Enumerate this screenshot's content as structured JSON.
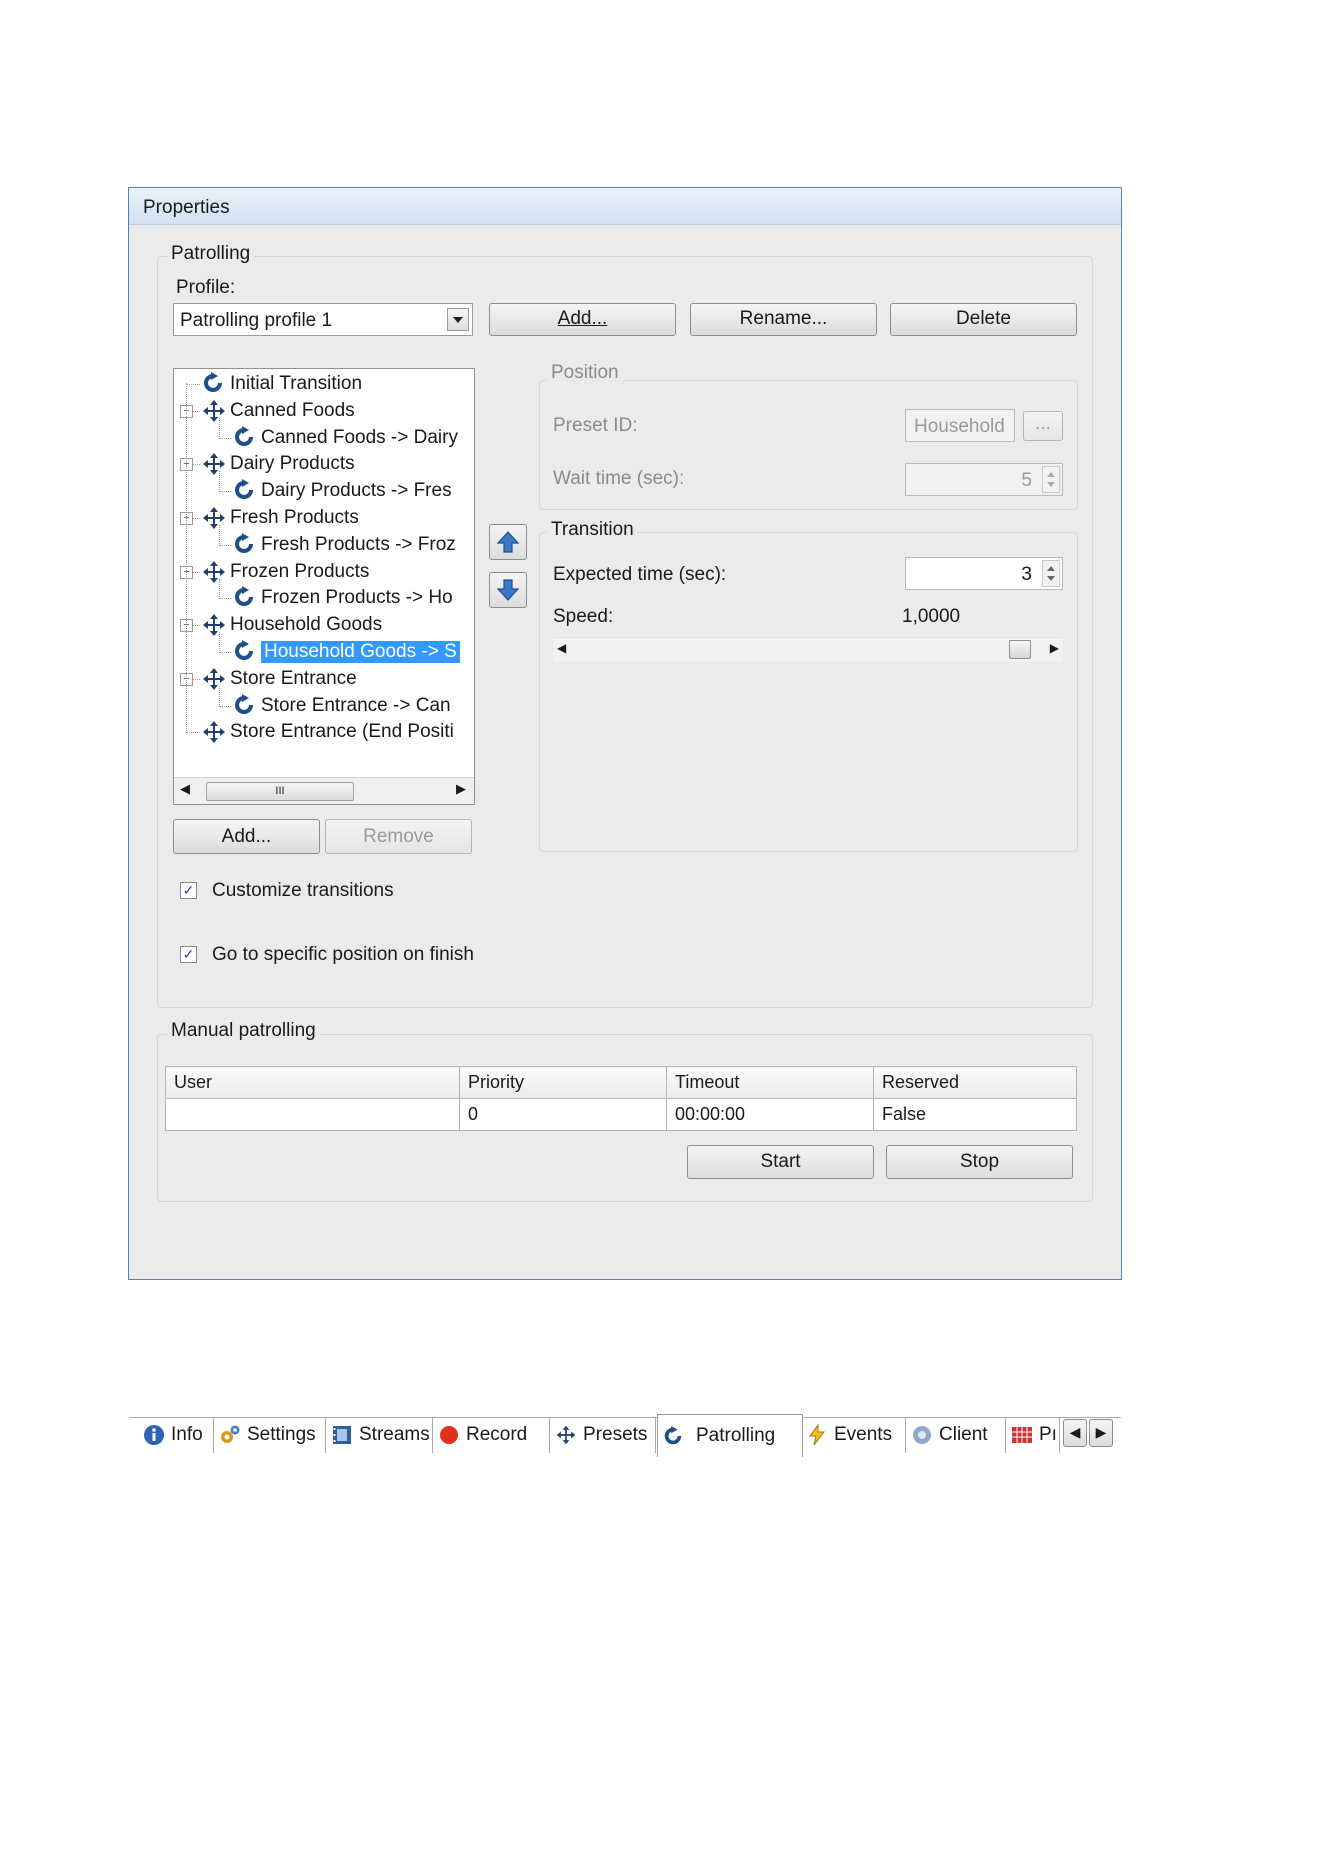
{
  "window": {
    "title": "Properties"
  },
  "patrolling": {
    "legend": "Patrolling",
    "profile_label": "Profile:",
    "profile_value": "Patrolling profile 1",
    "add_label": "Add...",
    "rename_label": "Rename...",
    "delete_label": "Delete",
    "tree": [
      {
        "label": "Initial Transition",
        "icon": "rotate-icon",
        "level": 0
      },
      {
        "label": "Canned Foods",
        "icon": "move-icon",
        "level": 0
      },
      {
        "label": "Canned Foods -> Dairy",
        "icon": "rotate-icon",
        "level": 1
      },
      {
        "label": "Dairy Products",
        "icon": "move-icon",
        "level": 0
      },
      {
        "label": "Dairy Products -> Fres",
        "icon": "rotate-icon",
        "level": 1
      },
      {
        "label": "Fresh Products",
        "icon": "move-icon",
        "level": 0
      },
      {
        "label": "Fresh Products -> Froz",
        "icon": "rotate-icon",
        "level": 1
      },
      {
        "label": "Frozen Products",
        "icon": "move-icon",
        "level": 0
      },
      {
        "label": "Frozen Products -> Ho",
        "icon": "rotate-icon",
        "level": 1
      },
      {
        "label": "Household Goods",
        "icon": "move-icon",
        "level": 0
      },
      {
        "label": "Household Goods -> S",
        "icon": "rotate-icon",
        "level": 1,
        "selected": true
      },
      {
        "label": "Store Entrance",
        "icon": "move-icon",
        "level": 0
      },
      {
        "label": "Store Entrance -> Can",
        "icon": "rotate-icon",
        "level": 1
      },
      {
        "label": "Store Entrance (End Positi",
        "icon": "move-icon",
        "level": 0
      }
    ],
    "tree_scroll_grip": "III",
    "tree_add_label": "Add...",
    "tree_remove_label": "Remove",
    "position": {
      "legend": "Position",
      "preset_label": "Preset ID:",
      "preset_value": "Household",
      "browse_label": "...",
      "wait_label": "Wait time (sec):",
      "wait_value": "5"
    },
    "transition": {
      "legend": "Transition",
      "expected_label": "Expected time (sec):",
      "expected_value": "3",
      "speed_label": "Speed:",
      "speed_value": "1,0000"
    },
    "customize_label": "Customize transitions",
    "customize_checked": true,
    "goto_label": "Go to specific position on finish",
    "goto_checked": true
  },
  "manual": {
    "legend": "Manual patrolling",
    "columns": [
      "User",
      "Priority",
      "Timeout",
      "Reserved"
    ],
    "row": [
      "",
      "0",
      "00:00:00",
      "False"
    ],
    "start_label": "Start",
    "stop_label": "Stop"
  },
  "tabs": [
    {
      "label": "Info",
      "icon": "info-icon"
    },
    {
      "label": "Settings",
      "icon": "settings-icon"
    },
    {
      "label": "Streams",
      "icon": "streams-icon"
    },
    {
      "label": "Record",
      "icon": "record-icon"
    },
    {
      "label": "Presets",
      "icon": "move-icon"
    },
    {
      "label": "Patrolling",
      "icon": "rotate-icon",
      "active": true
    },
    {
      "label": "Events",
      "icon": "events-icon"
    },
    {
      "label": "Client",
      "icon": "client-icon"
    },
    {
      "label": "Pı",
      "icon": "grid-icon"
    }
  ],
  "colors": {
    "selection": "#3399ff",
    "title_bar": "#d2e1f1",
    "border": "#5a7fa8"
  }
}
